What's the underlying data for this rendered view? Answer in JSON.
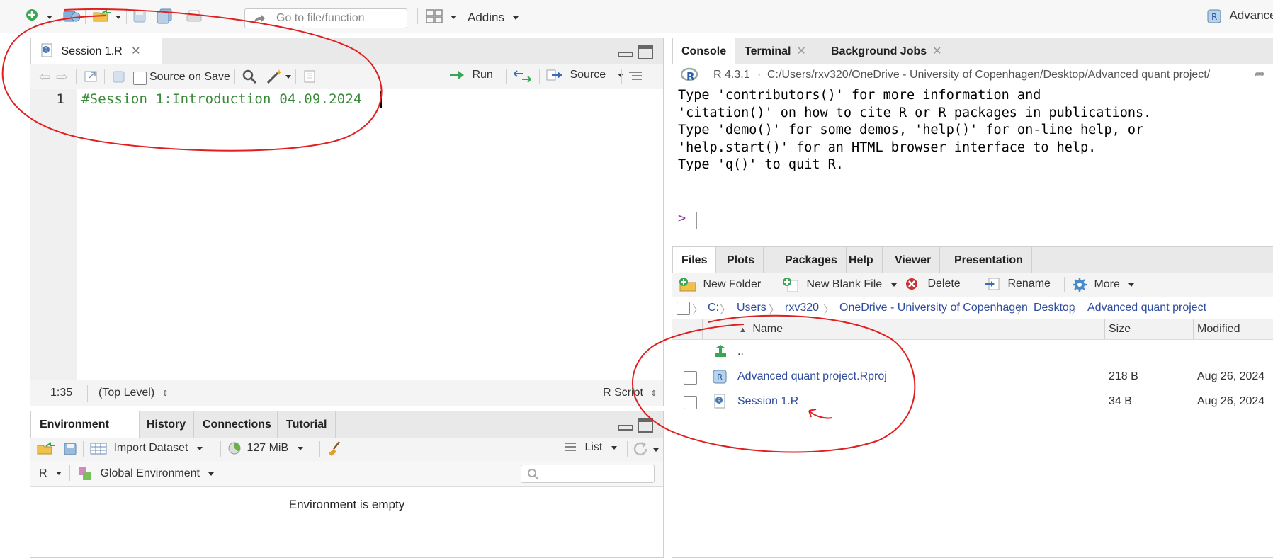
{
  "toolbar": {
    "goto_placeholder": "Go to file/function",
    "addins_label": "Addins",
    "project_label": "Advance"
  },
  "source_pane": {
    "tab_label": "Session 1.R",
    "source_on_save": "Source on Save",
    "run_label": "Run",
    "source_label": "Source",
    "code_lines": [
      {
        "num": "1",
        "text": "#Session 1:Introduction 04.09.2024"
      }
    ],
    "status_position": "1:35",
    "status_scope": "(Top Level)",
    "status_type": "R Script"
  },
  "env_pane": {
    "tabs": [
      "Environment",
      "History",
      "Connections",
      "Tutorial"
    ],
    "import_label": "Import Dataset",
    "memory_label": "127 MiB",
    "list_label": "List",
    "lang_label": "R",
    "env_label": "Global Environment",
    "empty_message": "Environment is empty"
  },
  "console_pane": {
    "tabs": [
      "Console",
      "Terminal",
      "Background Jobs"
    ],
    "r_version": "R 4.3.1",
    "path": "C:/Users/rxv320/OneDrive - University of Copenhagen/Desktop/Advanced quant project/",
    "output_lines": [
      "Type 'contributors()' for more information and",
      "'citation()' on how to cite R or R packages in publications.",
      "",
      "Type 'demo()' for some demos, 'help()' for on-line help, or",
      "'help.start()' for an HTML browser interface to help.",
      "Type 'q()' to quit R."
    ],
    "prompt": ">"
  },
  "files_pane": {
    "tabs": [
      "Files",
      "Plots",
      "Packages",
      "Help",
      "Viewer",
      "Presentation"
    ],
    "new_folder": "New Folder",
    "new_blank_file": "New Blank File",
    "delete": "Delete",
    "rename": "Rename",
    "more": "More",
    "breadcrumb": [
      "C:",
      "Users",
      "rxv320",
      "OneDrive - University of Copenhagen",
      "Desktop",
      "Advanced quant project"
    ],
    "columns": {
      "name": "Name",
      "size": "Size",
      "modified": "Modified"
    },
    "parent_dir": "..",
    "files": [
      {
        "name": "Advanced quant project.Rproj",
        "size": "218 B",
        "modified": "Aug 26, 2024"
      },
      {
        "name": "Session 1.R",
        "size": "34 B",
        "modified": "Aug 26, 2024"
      }
    ]
  },
  "colors": {
    "annotation": "#e02020",
    "code_comment": "#3a8a3a",
    "link": "#2e4b9e"
  }
}
